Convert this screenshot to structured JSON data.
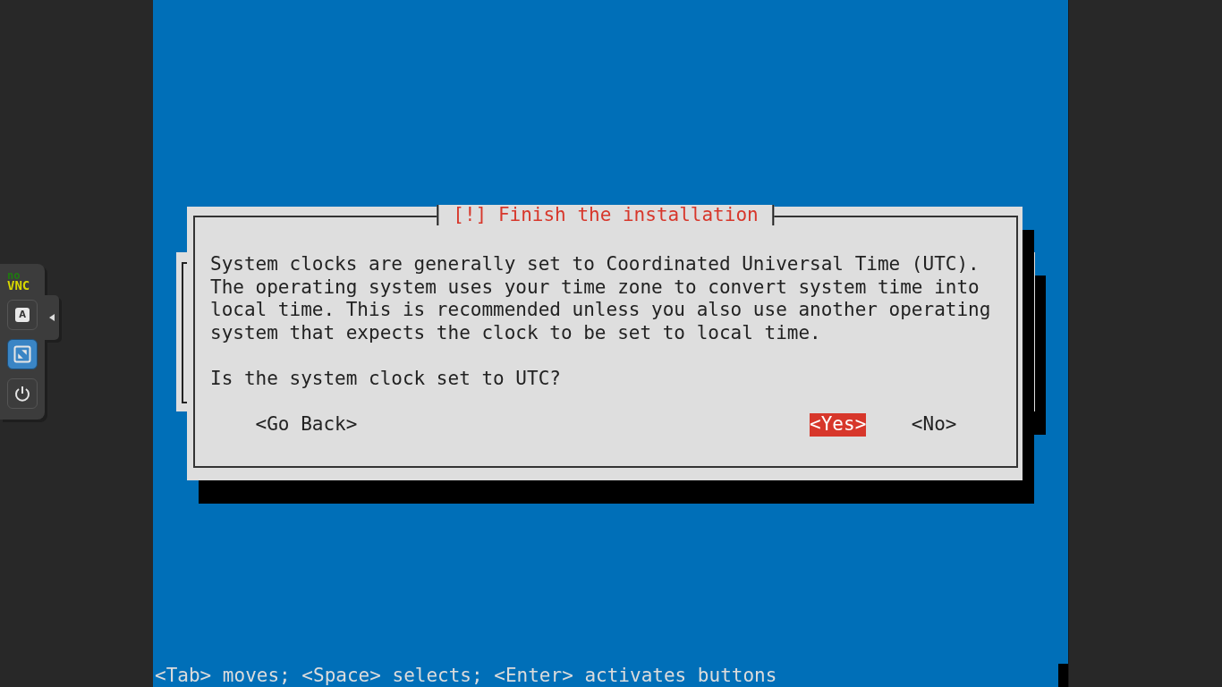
{
  "sidebar": {
    "logo": {
      "top": "no",
      "bottom": "VNC"
    },
    "buttons": [
      {
        "kind": "keyboard",
        "glyph": "A",
        "selected": false
      },
      {
        "kind": "fullscreen",
        "selected": true
      },
      {
        "kind": "power",
        "selected": false
      }
    ]
  },
  "dialog": {
    "title": "[!] Finish the installation",
    "message": "System clocks are generally set to Coordinated Universal Time (UTC).\nThe operating system uses your time zone to convert system time into\nlocal time. This is recommended unless you also use another operating\nsystem that expects the clock to be set to local time.",
    "question": "Is the system clock set to UTC?",
    "buttons": [
      {
        "label": "<Go Back>",
        "selected": false
      },
      {
        "label": "<Yes>",
        "selected": true
      },
      {
        "label": "<No>",
        "selected": false
      }
    ]
  },
  "status_line": "<Tab> moves; <Space> selects; <Enter> activates buttons"
}
